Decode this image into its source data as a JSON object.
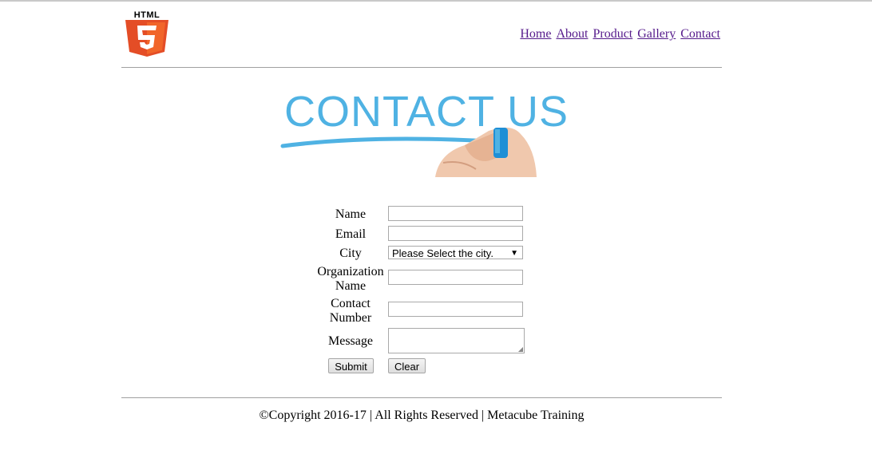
{
  "logo": {
    "text": "HTML",
    "icon": "html5-shield-icon",
    "color": "#e44d26"
  },
  "nav": {
    "items": [
      {
        "label": "Home"
      },
      {
        "label": "About"
      },
      {
        "label": "Product"
      },
      {
        "label": "Gallery"
      },
      {
        "label": "Contact"
      }
    ],
    "link_color": "#551a8b"
  },
  "hero": {
    "text": "CONTACT US",
    "color": "#4fb2e3"
  },
  "form": {
    "name_label": "Name",
    "email_label": "Email",
    "city_label": "City",
    "city_selected": "Please Select the city.",
    "org_label_1": "Organization",
    "org_label_2": "Name",
    "contact_label_1": "Contact",
    "contact_label_2": "Number",
    "message_label": "Message",
    "submit_label": "Submit",
    "clear_label": "Clear"
  },
  "footer": {
    "text": "©Copyright 2016-17 | All Rights Reserved | Metacube Training"
  }
}
